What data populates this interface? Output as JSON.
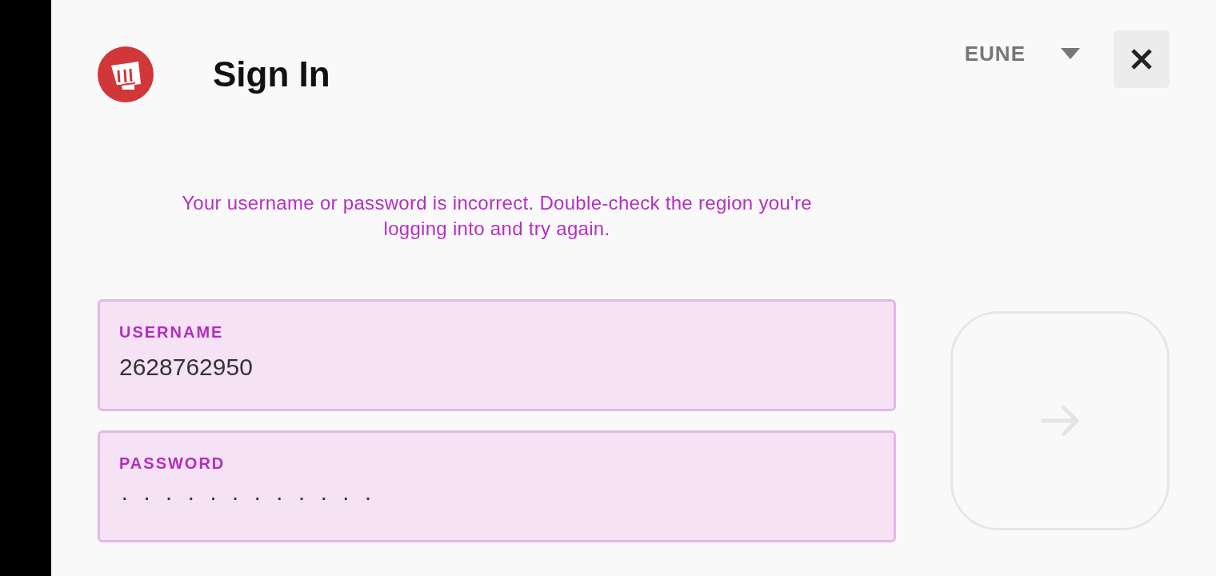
{
  "header": {
    "title": "Sign In",
    "region": "EUNE"
  },
  "error": "Your username or password is incorrect. Double-check the region you're logging into and try again.",
  "fields": [
    {
      "kind": "text",
      "label": "USERNAME",
      "value": "2628762950",
      "invalid": true
    },
    {
      "kind": "password",
      "label": "PASSWORD",
      "value": "············",
      "invalid": true
    }
  ],
  "submit": {
    "disabled": true
  }
}
